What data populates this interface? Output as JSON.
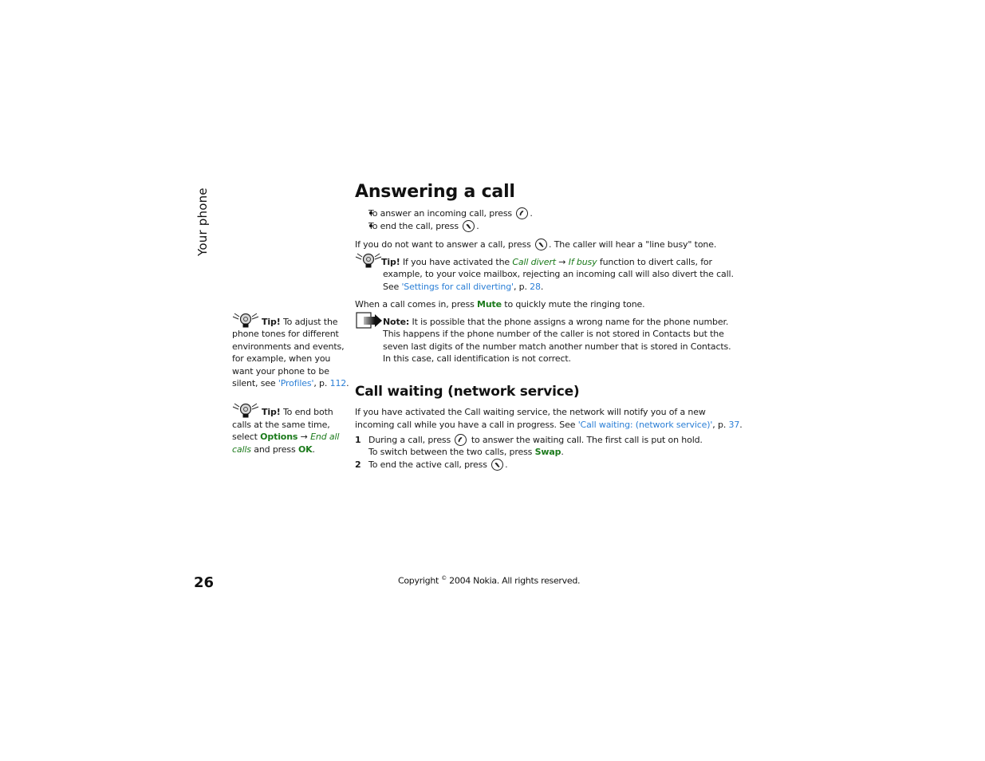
{
  "side_tab": {
    "label": "Your phone"
  },
  "main": {
    "title": "Answering a call",
    "bullets": [
      {
        "text": "To answer an incoming call, press",
        "key_icon": "call-key-icon",
        "suffix": "."
      },
      {
        "text": "To end the call, press",
        "key_icon": "end-key-icon",
        "suffix": "."
      }
    ],
    "reject_para": {
      "before": "If you do not want to answer a call, press",
      "key_icon": "end-key-icon",
      "after": ". The caller will hear a \"line busy\" tone."
    },
    "tip_divert": {
      "tip_label": "Tip!",
      "line1_a": "If you have activated the",
      "menu_1": "Call divert",
      "arrow": "→",
      "menu_2": "If busy",
      "line1_b": "function to divert calls, for",
      "line2": "example, to your voice mailbox, rejecting an incoming call will also divert the call.",
      "line3_a": "See",
      "link_text": "'Settings for call diverting'",
      "line3_b": ", p.",
      "page_ref": "28",
      "line3_c": "."
    },
    "mute_para": {
      "before": "When a call comes in, press",
      "softkey": "Mute",
      "after": "to quickly mute the ringing tone."
    },
    "note": {
      "label": "Note:",
      "line1": "It is possible that the phone assigns a wrong name for the phone number.",
      "line2": "This happens if the phone number of the caller is not stored in Contacts but the",
      "line3": "seven last digits of the number match another number that is stored in Contacts.",
      "line4": "In this case, call identification is not correct."
    },
    "subtitle": "Call waiting (network service)",
    "cw_para": {
      "line1": "If you have activated the Call waiting service, the network will notify you of a new",
      "line2_a": "incoming call while you have a call in progress. See",
      "link_text": "'Call waiting: (network service)'",
      "line2_b": ", p.",
      "page_ref": "37",
      "line2_c": "."
    },
    "steps": [
      {
        "num": "1",
        "line1_a": "During a call, press",
        "key_icon": "call-key-icon",
        "line1_b": "to answer the waiting call. The first call is put on hold.",
        "line2_a": "To switch between the two calls, press",
        "softkey": "Swap",
        "line2_b": "."
      },
      {
        "num": "2",
        "line1_a": "To end the active call, press",
        "key_icon": "end-key-icon",
        "line1_b": "."
      }
    ]
  },
  "sidebar_tips": [
    {
      "tip_label": "Tip!",
      "lines": [
        "To adjust the",
        "phone tones for different",
        "environments and events,",
        "for example, when you",
        "want your phone to be"
      ],
      "last_a": "silent, see",
      "link_text": "'Profiles'",
      "last_b": ", p.",
      "page_ref": "112",
      "last_c": "."
    },
    {
      "tip_label": "Tip!",
      "line1": "To end both",
      "line2": "calls at the same time,",
      "line3_a": "select",
      "softkey_1": "Options",
      "arrow": "→",
      "menu_1a": "End all",
      "menu_1b": "calls",
      "line4_b": "and press",
      "softkey_2": "OK",
      "line4_c": "."
    }
  ],
  "footer": {
    "page_number": "26",
    "copyright_a": "Copyright",
    "copyright_symbol": "©",
    "copyright_b": "2004 Nokia. All rights reserved."
  },
  "colors": {
    "softkey_green": "#1b7a1b",
    "link_blue": "#2b7fd6",
    "text": "#1a1a1a"
  }
}
